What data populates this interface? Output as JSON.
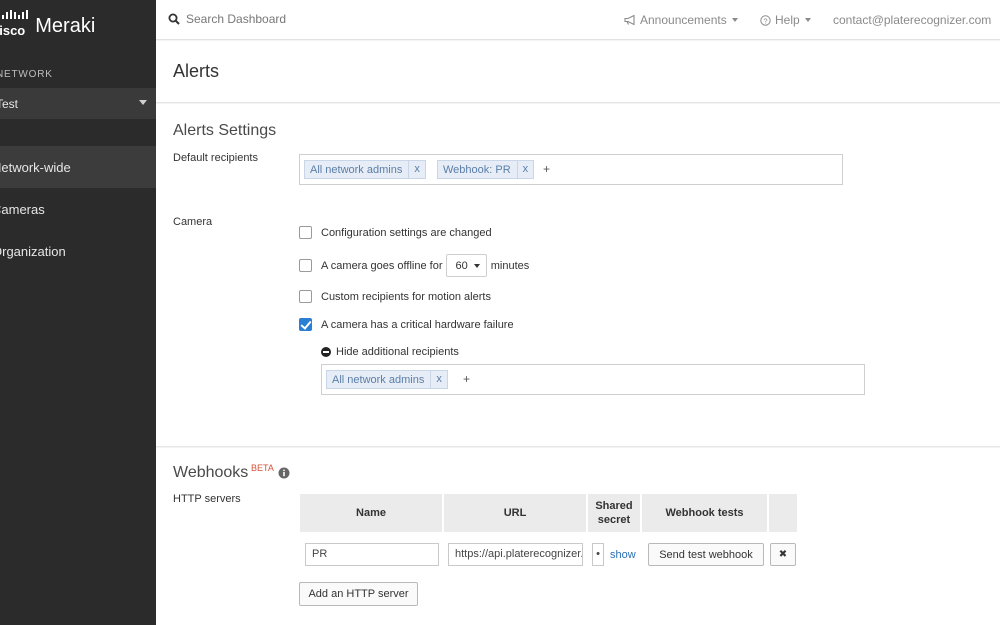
{
  "sidebar": {
    "brand": {
      "cisco": "cisco",
      "product": "Meraki"
    },
    "network_label": "NETWORK",
    "network_selected": "Test",
    "items": [
      {
        "label": "Network-wide",
        "active": true
      },
      {
        "label": "Cameras",
        "active": false
      },
      {
        "label": "Organization",
        "active": false
      }
    ]
  },
  "topbar": {
    "search_placeholder": "Search Dashboard",
    "announcements": "Announcements",
    "help": "Help",
    "account": "contact@platerecognizer.com"
  },
  "page": {
    "title": "Alerts"
  },
  "alerts_settings": {
    "title": "Alerts Settings",
    "default_recipients_label": "Default recipients",
    "default_recipients": [
      {
        "label": "All network admins",
        "remove": "x"
      },
      {
        "label": "Webhook: PR",
        "remove": "x"
      }
    ],
    "add_symbol": "+",
    "camera_label": "Camera",
    "camera_options": {
      "config_changed": {
        "label": "Configuration settings are changed",
        "checked": false
      },
      "offline": {
        "label_before": "A camera goes offline for",
        "minutes_value": "60",
        "label_after": "minutes",
        "checked": false
      },
      "motion": {
        "label": "Custom recipients for motion alerts",
        "checked": false
      },
      "hardware": {
        "label": "A camera has a critical hardware failure",
        "checked": true
      }
    },
    "hide_recipients_label": "Hide additional recipients",
    "additional_recipients": [
      {
        "label": "All network admins",
        "remove": "x"
      }
    ]
  },
  "webhooks": {
    "title": "Webhooks",
    "beta": "BETA",
    "http_servers_label": "HTTP servers",
    "columns": {
      "name": "Name",
      "url": "URL",
      "shared_secret_line1": "Shared",
      "shared_secret_line2": "secret",
      "tests": "Webhook tests"
    },
    "row": {
      "name": "PR",
      "url": "https://api.platerecognizer.com",
      "secret": "•",
      "show": "show",
      "send_test": "Send test webhook",
      "delete": "✖"
    },
    "add_server": "Add an HTTP server"
  }
}
